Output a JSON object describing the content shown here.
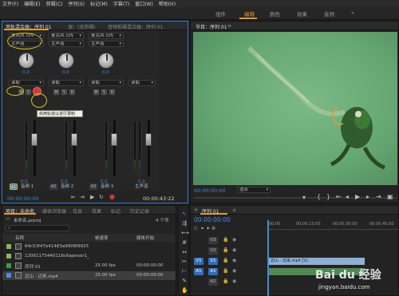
{
  "menubar": [
    "文件(F)",
    "编辑(E)",
    "剪辑(C)",
    "序列(S)",
    "标记(M)",
    "字幕(T)",
    "窗口(W)",
    "帮助(H)"
  ],
  "workspace": {
    "tabs": [
      {
        "label": "组件",
        "active": false
      },
      {
        "label": "编辑",
        "active": true
      },
      {
        "label": "颜色",
        "active": false
      },
      {
        "label": "效果",
        "active": false
      },
      {
        "label": "音频",
        "active": false
      }
    ],
    "more": "»"
  },
  "mixer": {
    "tabs": [
      {
        "label": "音轨混合器：序列 01",
        "active": true
      },
      {
        "label": "源：(无剪辑)",
        "active": false
      },
      {
        "label": "音频剪辑混合器：序列 01",
        "active": false
      }
    ],
    "tracks": [
      {
        "input": "麦克风 (US",
        "channel": "主声道",
        "pan_value": "0.0",
        "automation": "读取",
        "volume_value": "0.0",
        "id": "A1",
        "name": "音频 1",
        "highlight": true
      },
      {
        "input": "麦克风 (US",
        "channel": "主声道",
        "pan_value": "0.0",
        "automation": "读取",
        "volume_value": "0.0",
        "id": "A2",
        "name": "音频 2",
        "highlight": false
      },
      {
        "input": "麦克风 (US",
        "channel": "主声道",
        "pan_value": "0.0",
        "automation": "读取",
        "volume_value": "0.0",
        "id": "A3",
        "name": "音频 3",
        "highlight": false
      },
      {
        "input": "",
        "channel": "",
        "pan_value": "0.0",
        "automation": "读取",
        "volume_value": "0.0",
        "id": "",
        "name": "主声道",
        "highlight": false
      }
    ],
    "msr": [
      "M",
      "S",
      "R"
    ],
    "tooltip": "启用轨道以进行录制",
    "time_left": "00:00:00:00",
    "time_right": "00:00:43:22"
  },
  "monitor": {
    "tab": "节目：序列 01",
    "timecode": "00:00:00:00",
    "fit": "适合"
  },
  "project": {
    "tabs": [
      {
        "label": "项目：未命名",
        "active": true
      },
      {
        "label": "媒体浏览器",
        "active": false
      },
      {
        "label": "信息",
        "active": false
      },
      {
        "label": "效果",
        "active": false
      },
      {
        "label": "标记",
        "active": false
      },
      {
        "label": "历史记录",
        "active": false
      }
    ],
    "file": "未命名.prproj",
    "count": "4 个项",
    "columns": [
      "名称",
      "帧速率",
      "媒体开始"
    ],
    "rows": [
      {
        "name": "64c53f47e41483a9909f9925",
        "fps": "",
        "start": "",
        "color": "#8ab55a",
        "selected": false
      },
      {
        "name": "12061175440116c6ajersor1_",
        "fps": "",
        "start": "",
        "color": "#8ab55a",
        "selected": false
      },
      {
        "name": "序列 01",
        "fps": "25.00 fps",
        "start": "00:00:00:00",
        "color": "#3c9a52",
        "selected": false
      },
      {
        "name": "迈山 - 迈来.mp4",
        "fps": "25.00 fps",
        "start": "00:00:00:00",
        "color": "#4a8fd6",
        "selected": true
      }
    ]
  },
  "timeline": {
    "tab": "序列 01",
    "timecode": "00:00:00:00",
    "ruler": [
      "00:00",
      "00:00:15:00",
      "00:00:30:00",
      "00:00:45:00"
    ],
    "tracks": [
      {
        "src": "",
        "id": "V3",
        "clip": ""
      },
      {
        "src": "",
        "id": "V2",
        "clip": ""
      },
      {
        "src": "V1",
        "id": "V1",
        "clip": "迈山 - 迈来.mp4 [V]"
      },
      {
        "src": "A1",
        "id": "A1",
        "clip": ""
      },
      {
        "src": "",
        "id": "A2",
        "clip": ""
      }
    ]
  },
  "watermark": {
    "text": "Bai du 经验",
    "url": "jingyan.baidu.com"
  }
}
